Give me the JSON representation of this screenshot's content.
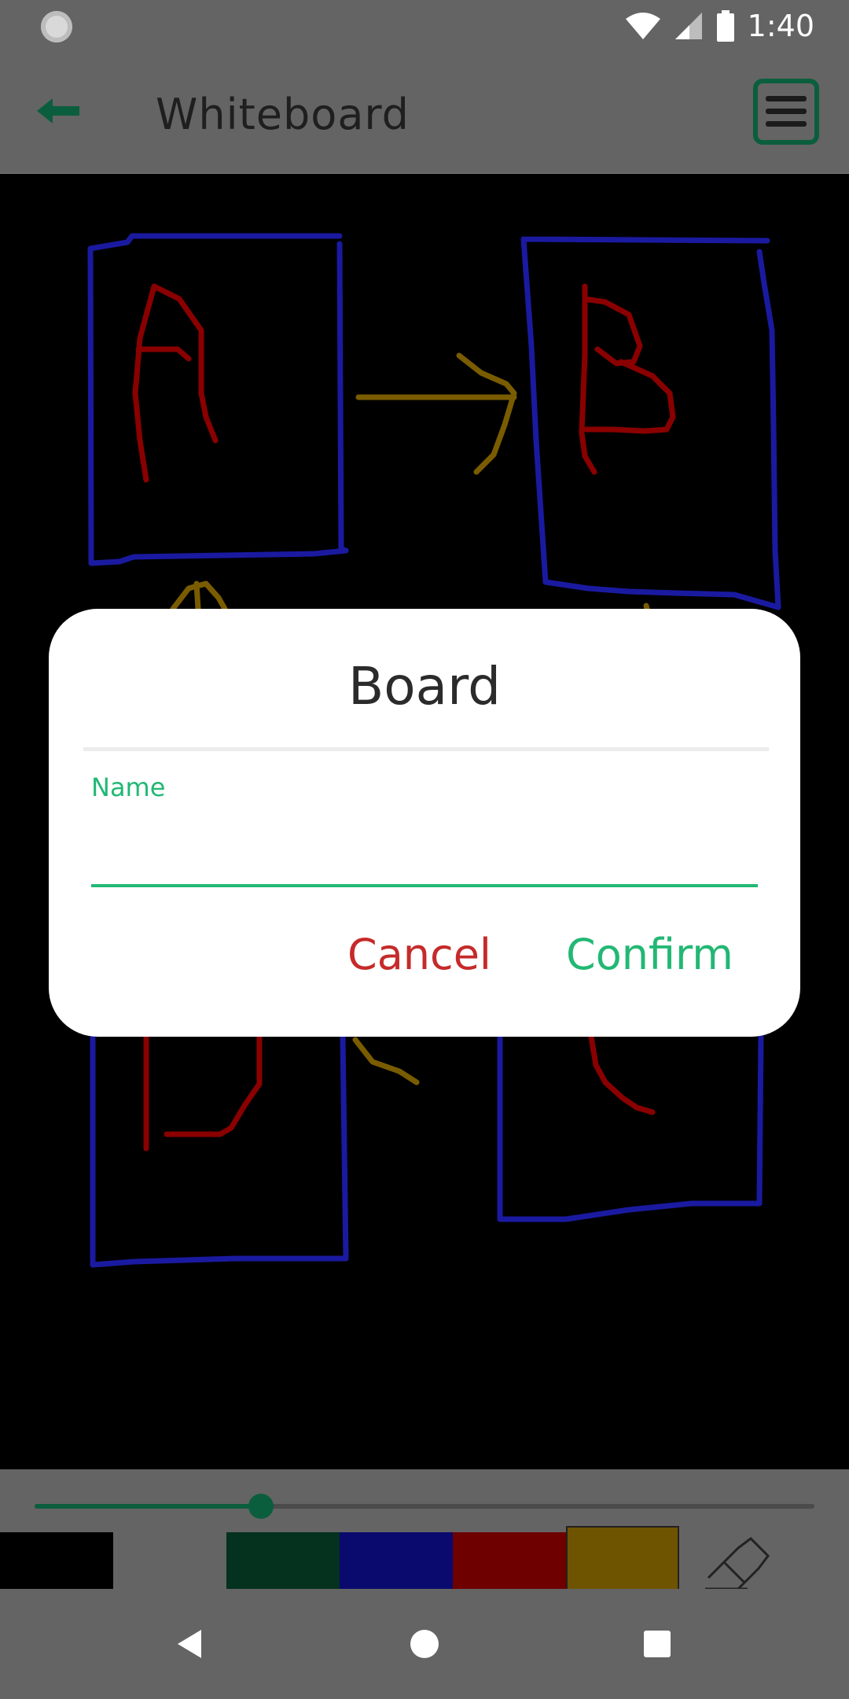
{
  "status_bar": {
    "time": "1:40",
    "icons": [
      "sync-indicator-icon",
      "wifi-icon",
      "cell-signal-icon",
      "battery-icon"
    ]
  },
  "toolbar": {
    "title": "Whiteboard",
    "back_icon": "back-arrow-icon",
    "menu_icon": "hamburger-menu-icon",
    "accent": "#0b5e3d"
  },
  "canvas": {
    "background": "#000000",
    "drawing_letters": [
      "A",
      "B",
      "D",
      "C"
    ],
    "stroke_colors": [
      "#1a1aa0",
      "#8a0000",
      "#7a5c00"
    ]
  },
  "dialog": {
    "title": "Board",
    "field": {
      "label": "Name",
      "value": "",
      "placeholder": ""
    },
    "cancel_label": "Cancel",
    "confirm_label": "Confirm",
    "cancel_color": "#c62a2a",
    "confirm_color": "#22b874"
  },
  "tools": {
    "brush_size_fraction": 0.29,
    "palette": [
      {
        "name": "black",
        "color": "#000000",
        "selected": false
      },
      {
        "name": "gray",
        "color": "#646464",
        "selected": false
      },
      {
        "name": "green",
        "color": "#05321e",
        "selected": false
      },
      {
        "name": "blue",
        "color": "#0a0a6e",
        "selected": false
      },
      {
        "name": "red",
        "color": "#6e0000",
        "selected": false
      },
      {
        "name": "gold",
        "color": "#6e5400",
        "selected": true
      }
    ],
    "eraser_icon": "eraser-icon"
  },
  "nav_bar": {
    "icons": [
      "back-triangle-icon",
      "home-circle-icon",
      "recents-square-icon"
    ]
  }
}
